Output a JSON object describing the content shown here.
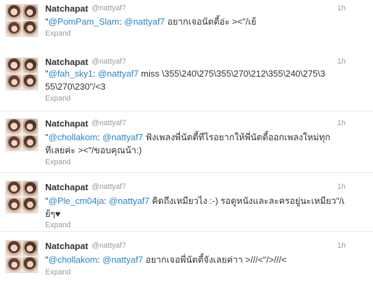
{
  "tweets": [
    {
      "name": "Natchapat",
      "handle": "@nattyaf7",
      "time": "1h",
      "segments": [
        {
          "t": "\"",
          "mention": false
        },
        {
          "t": "@PomPam_Slam",
          "mention": true
        },
        {
          "t": ": ",
          "mention": false
        },
        {
          "t": "@nattyaf7",
          "mention": true
        },
        {
          "t": " อยากเจอนัตตี้อ่ะ ><\"/เย้",
          "mention": false
        }
      ],
      "expand": "Expand"
    },
    {
      "name": "Natchapat",
      "handle": "@nattyaf7",
      "time": "1h",
      "segments": [
        {
          "t": "\"",
          "mention": false
        },
        {
          "t": "@fah_sky1",
          "mention": true
        },
        {
          "t": ": ",
          "mention": false
        },
        {
          "t": "@nattyaf7",
          "mention": true
        },
        {
          "t": " miss \\355\\240\\275\\355\\270\\212\\355\\240\\275\\355\\270\\230\"/<3",
          "mention": false
        }
      ],
      "expand": "Expand"
    },
    {
      "name": "Natchapat",
      "handle": "@nattyaf7",
      "time": "1h",
      "segments": [
        {
          "t": "\"",
          "mention": false
        },
        {
          "t": "@chollakom",
          "mention": true
        },
        {
          "t": ": ",
          "mention": false
        },
        {
          "t": "@nattyaf7",
          "mention": true
        },
        {
          "t": " ฟังเพลงพี่นัตตี้ทีไรอยากให้พี่นัตตี้ออกเพลงใหม่ทุกทีเลยค่ะ ><\"/ขอบคุณน้า:)",
          "mention": false
        }
      ],
      "expand": "Expand"
    },
    {
      "name": "Natchapat",
      "handle": "@nattyaf7",
      "time": "1h",
      "segments": [
        {
          "t": "\"",
          "mention": false
        },
        {
          "t": "@Ple_cm04ja",
          "mention": true
        },
        {
          "t": ": ",
          "mention": false
        },
        {
          "t": "@nattyaf7",
          "mention": true
        },
        {
          "t": " คิดถึงเหมียวไง :-) รอดูหนังและละครอยู่นะเหมียว\"/เย้ๆ♥",
          "mention": false
        }
      ],
      "expand": "Expand"
    },
    {
      "name": "Natchapat",
      "handle": "@nattyaf7",
      "time": "1h",
      "segments": [
        {
          "t": "\"",
          "mention": false
        },
        {
          "t": "@chollakom",
          "mention": true
        },
        {
          "t": ": ",
          "mention": false
        },
        {
          "t": "@nattyaf7",
          "mention": true
        },
        {
          "t": " อยากเจอพี่นัตตี้จังเลยค่าา >///<\"/>///<",
          "mention": false
        }
      ],
      "expand": "Expand"
    }
  ],
  "colors": {
    "name": "#333333",
    "meta": "#999999",
    "mention": "#2a86c7",
    "divider": "#e8e8e8"
  }
}
